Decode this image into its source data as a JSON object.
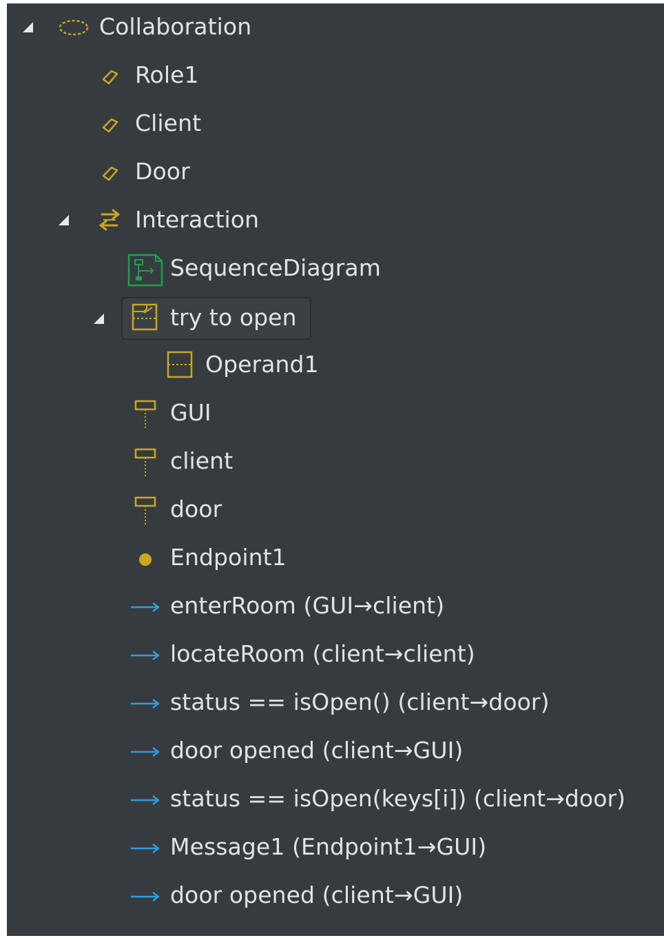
{
  "colors": {
    "panel_bg": "#363b40",
    "text": "#e2e3e4",
    "accent_yellow": "#c9a820",
    "accent_green": "#1aa34a",
    "accent_blue": "#2d9fe0"
  },
  "tree": {
    "collaboration": {
      "label": "Collaboration",
      "icon": "collaboration-icon"
    },
    "roles": [
      {
        "label": "Role1",
        "icon": "role-icon"
      },
      {
        "label": "Client",
        "icon": "role-icon"
      },
      {
        "label": "Door",
        "icon": "role-icon"
      }
    ],
    "interaction": {
      "label": "Interaction",
      "icon": "interaction-icon"
    },
    "sequence_diagram": {
      "label": "SequenceDiagram",
      "icon": "sequence-diagram-icon"
    },
    "fragment": {
      "label": "try to open",
      "icon": "combined-fragment-icon"
    },
    "operand": {
      "label": "Operand1",
      "icon": "operand-icon"
    },
    "lifelines": [
      {
        "label": "GUI",
        "icon": "lifeline-icon"
      },
      {
        "label": "client",
        "icon": "lifeline-icon"
      },
      {
        "label": "door",
        "icon": "lifeline-icon"
      }
    ],
    "endpoint": {
      "label": "Endpoint1",
      "icon": "endpoint-icon"
    },
    "messages": [
      {
        "label": "enterRoom (GUI→client)",
        "icon": "message-arrow-icon"
      },
      {
        "label": "locateRoom (client→client)",
        "icon": "message-arrow-icon"
      },
      {
        "label": "status == isOpen() (client→door)",
        "icon": "message-arrow-icon"
      },
      {
        "label": "door opened (client→GUI)",
        "icon": "message-arrow-icon"
      },
      {
        "label": "status == isOpen(keys[i]) (client→door)",
        "icon": "message-arrow-icon"
      },
      {
        "label": "Message1 (Endpoint1→GUI)",
        "icon": "message-arrow-icon"
      },
      {
        "label": "door opened (client→GUI)",
        "icon": "message-arrow-icon"
      }
    ]
  }
}
